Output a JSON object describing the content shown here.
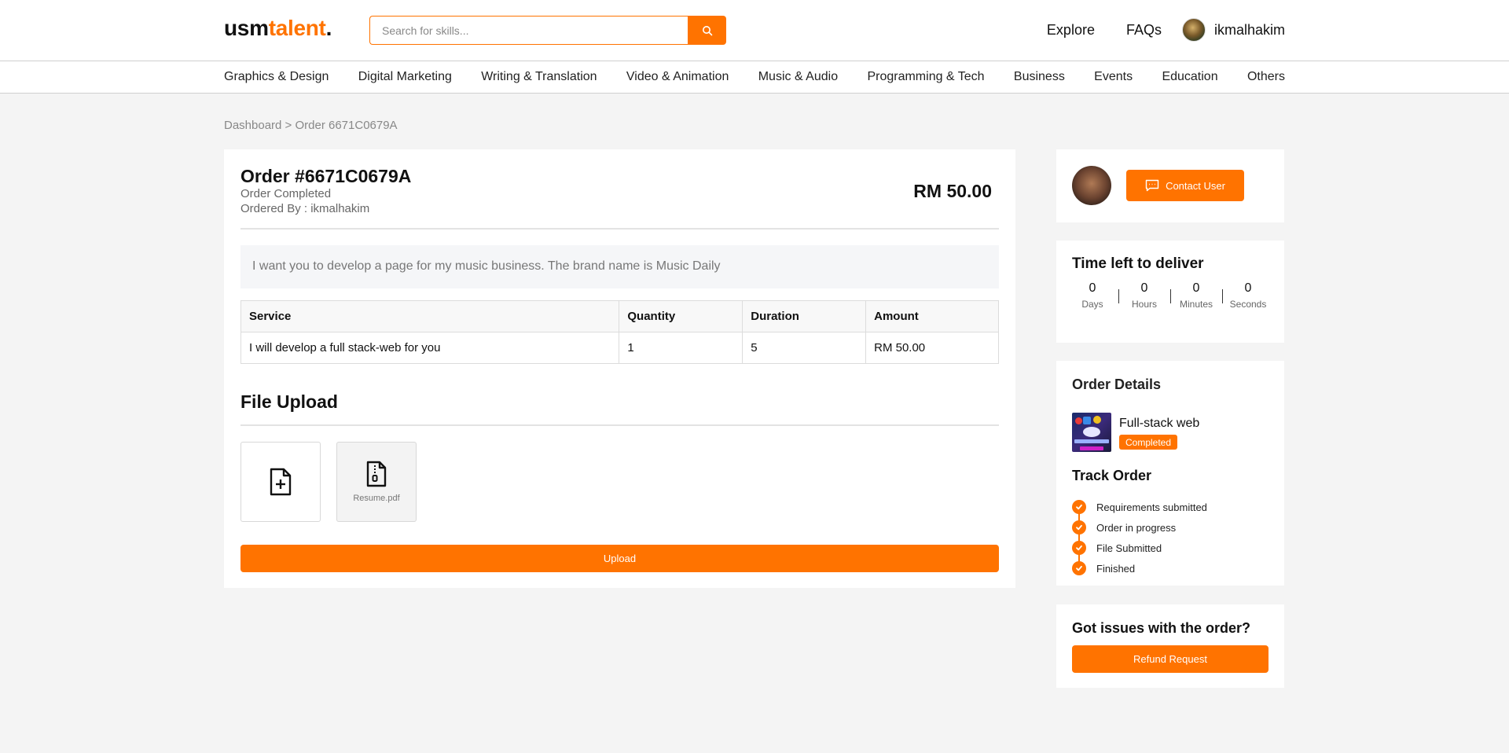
{
  "header": {
    "logo_part1": "usm",
    "logo_part2": "talent",
    "logo_part3": ".",
    "search_placeholder": "Search for skills...",
    "search_icon": "search-icon",
    "nav_explore": "Explore",
    "nav_faqs": "FAQs",
    "username": "ikmalhakim"
  },
  "categories": [
    "Graphics & Design",
    "Digital Marketing",
    "Writing & Translation",
    "Video & Animation",
    "Music & Audio",
    "Programming & Tech",
    "Business",
    "Events",
    "Education",
    "Others"
  ],
  "breadcrumb": "Dashboard > Order 6671C0679A",
  "order": {
    "title": "Order #6671C0679A",
    "status": "Order Completed",
    "ordered_by": "Ordered By : ikmalhakim",
    "price": "RM 50.00",
    "requirement": "I want you to develop a page for my music business. The brand name is Music Daily",
    "table": {
      "headers": [
        "Service",
        "Quantity",
        "Duration",
        "Amount"
      ],
      "rows": [
        [
          "I will develop a full stack-web for you",
          "1",
          "5",
          "RM 50.00"
        ]
      ]
    },
    "file_upload_title": "File Upload",
    "uploaded_file": "Resume.pdf",
    "upload_label": "Upload"
  },
  "contact": {
    "label": "Contact User"
  },
  "timer": {
    "title": "Time left to deliver",
    "units": [
      {
        "value": "0",
        "label": "Days"
      },
      {
        "value": "0",
        "label": "Hours"
      },
      {
        "value": "0",
        "label": "Minutes"
      },
      {
        "value": "0",
        "label": "Seconds"
      }
    ]
  },
  "details": {
    "title": "Order Details",
    "service_name": "Full-stack web",
    "badge": "Completed",
    "track_title": "Track Order",
    "steps": [
      "Requirements submitted",
      "Order in progress",
      "File Submitted",
      "Finished"
    ]
  },
  "issues": {
    "title": "Got issues with the order?",
    "refund_label": "Refund Request"
  },
  "colors": {
    "accent": "#ff7300",
    "background": "#f4f4f4"
  }
}
